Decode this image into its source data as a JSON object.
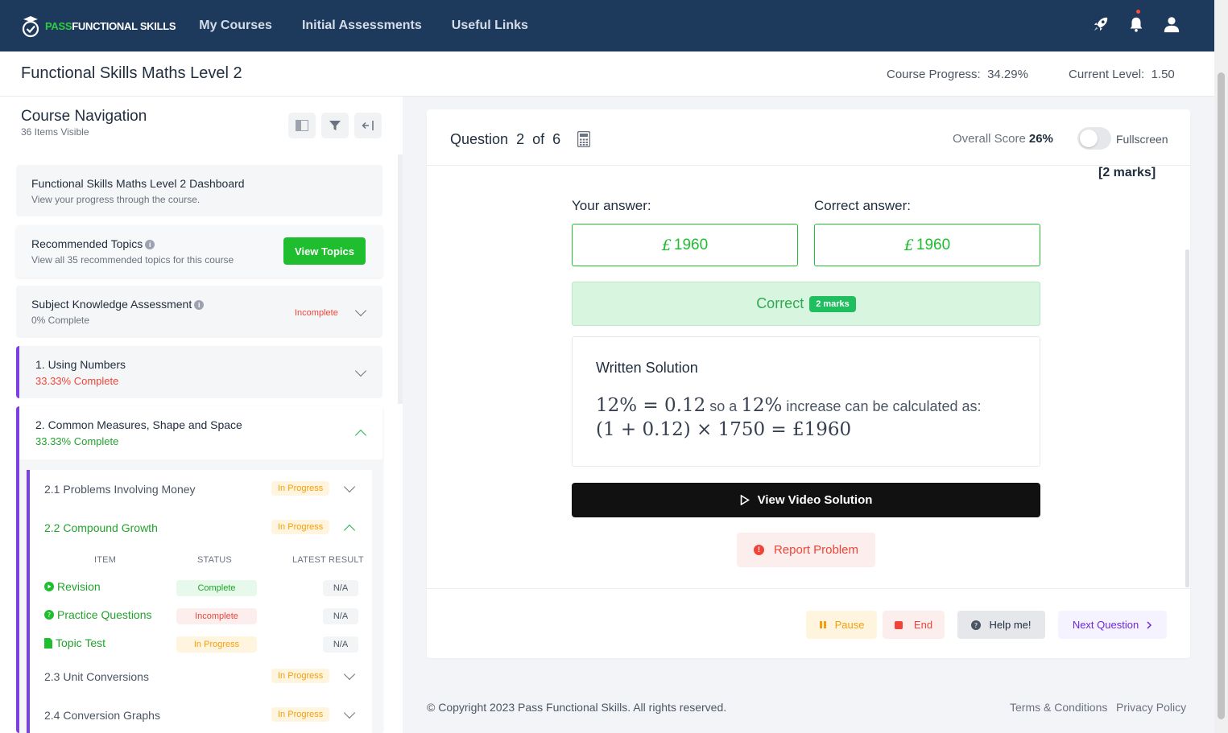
{
  "brand": {
    "green_part": "PASS",
    "white_part": "FUNCTIONAL SKILLS"
  },
  "nav": [
    "My Courses",
    "Initial Assessments",
    "Useful Links"
  ],
  "course": {
    "title": "Functional Skills Maths Level 2",
    "progress_label": "Course Progress:",
    "progress_value": "34.29%",
    "level_label": "Current Level:",
    "level_value": "1.50"
  },
  "sidebar": {
    "title": "Course Navigation",
    "subtitle": "36 Items Visible",
    "dashboard": {
      "title": "Functional Skills Maths Level 2 Dashboard",
      "sub": "View your progress through the course."
    },
    "recommended": {
      "title": "Recommended Topics",
      "sub": "View all 35 recommended topics for this course",
      "button": "View Topics"
    },
    "ska": {
      "title": "Subject Knowledge Assessment",
      "sub": "0% Complete",
      "status": "Incomplete"
    },
    "topic1": {
      "title": "1. Using Numbers",
      "sub": "33.33% Complete"
    },
    "topic2": {
      "title": "2. Common Measures, Shape and Space",
      "sub": "33.33% Complete"
    },
    "subtopics": [
      {
        "label": "2.1 Problems Involving Money",
        "status": "In Progress"
      },
      {
        "label": "2.2 Compound Growth",
        "status": "In Progress"
      },
      {
        "label": "2.3 Unit Conversions",
        "status": "In Progress"
      },
      {
        "label": "2.4 Conversion Graphs",
        "status": "In Progress"
      }
    ],
    "table_headers": [
      "ITEM",
      "STATUS",
      "LATEST RESULT"
    ],
    "items": [
      {
        "name": "Revision",
        "status": "Complete",
        "result": "N/A"
      },
      {
        "name": "Practice Questions",
        "status": "Incomplete",
        "result": "N/A"
      },
      {
        "name": "Topic Test",
        "status": "In Progress",
        "result": "N/A"
      }
    ]
  },
  "question": {
    "label": "Question",
    "number": "2",
    "of": "of",
    "total": "6",
    "score_label": "Overall Score",
    "score_value": "26%",
    "fullscreen_label": "Fullscreen",
    "marks": "[2 marks]",
    "your_answer_label": "Your answer:",
    "correct_answer_label": "Correct answer:",
    "currency": "£",
    "your_answer": "1960",
    "correct_answer": "1960",
    "result": "Correct",
    "result_badge": "2 marks",
    "solution_title": "Written Solution",
    "solution_line1_math_a": "12% = 0.12",
    "solution_line1_text_a": " so a ",
    "solution_line1_math_b": "12%",
    "solution_line1_text_b": " increase can be calculated as:",
    "solution_line2_math": "(1 + 0.12) × 1750 = £1960",
    "video_button": "View Video Solution",
    "report_button": "Report Problem"
  },
  "controls": {
    "pause": "Pause",
    "end": "End",
    "help": "Help me!",
    "next": "Next Question"
  },
  "footer": {
    "copyright": "© Copyright 2023 Pass Functional Skills. All rights reserved.",
    "terms": "Terms & Conditions",
    "privacy": "Privacy Policy"
  },
  "colors": {
    "navy": "#1d3a5c",
    "green": "#1fbe2f",
    "purple": "#7b3fe4",
    "red": "#f04438",
    "amber": "#f59e0b"
  }
}
